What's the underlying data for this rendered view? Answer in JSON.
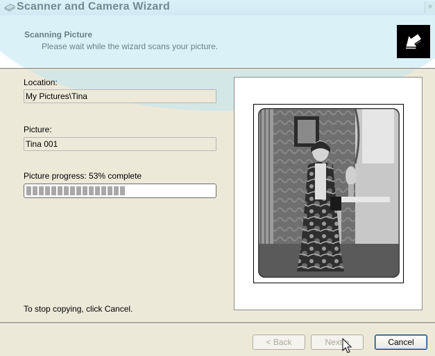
{
  "window": {
    "title": "Scanner and Camera Wizard",
    "close_glyph": "×"
  },
  "header": {
    "title": "Scanning Picture",
    "subtitle": "Please wait while the wizard scans your picture.",
    "icon": "wizard-logo-icon"
  },
  "form": {
    "location_label": "Location:",
    "location_value": "My Pictures\\Tina",
    "picture_label": "Picture:",
    "picture_value": "Tina 001",
    "progress_label": "Picture progress: 53% complete",
    "progress_fraction": 0.53
  },
  "footer": {
    "hint": "To stop copying, click Cancel.",
    "back_label": "< Back",
    "next_label": "Next >",
    "cancel_label": "Cancel"
  },
  "colors": {
    "dialog_bg": "#ece9d8",
    "header_bg": "#ffffff",
    "default_button_border": "#003c74"
  }
}
